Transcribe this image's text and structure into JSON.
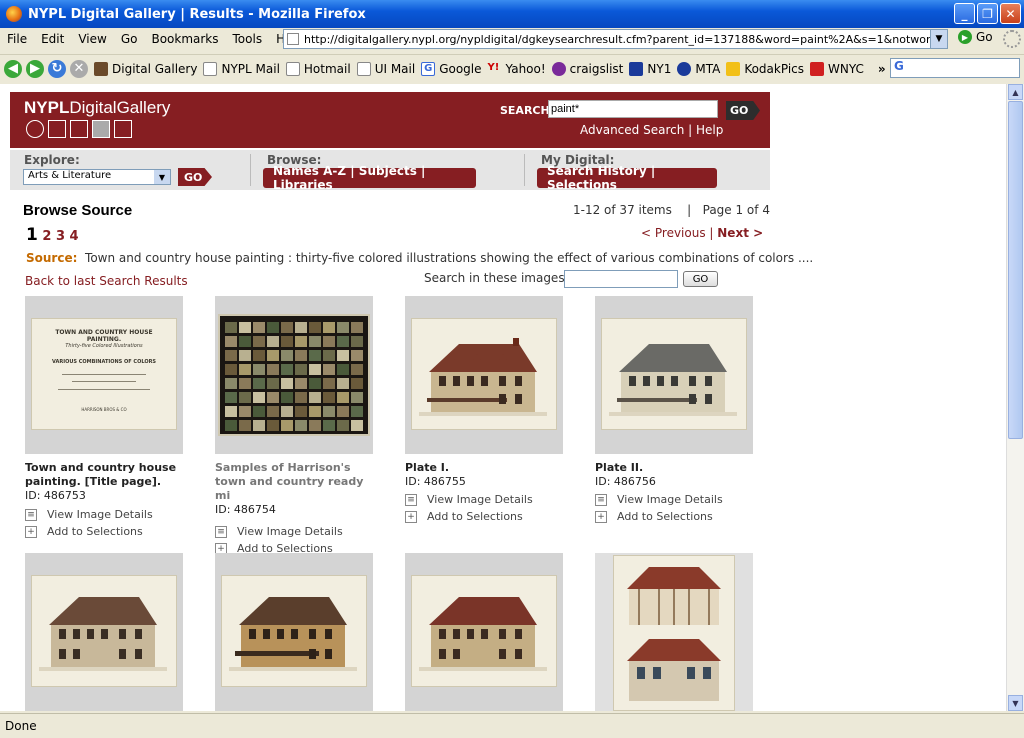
{
  "browser": {
    "window_title": "NYPL Digital Gallery  |  Results - Mozilla Firefox",
    "menu": [
      "File",
      "Edit",
      "View",
      "Go",
      "Bookmarks",
      "Tools",
      "Help"
    ],
    "url": "http://digitalgallery.nypl.org/nypldigital/dgkeysearchresult.cfm?parent_id=137188&word=paint%2A&s=1&notword=&d=bg&c=&",
    "go_label": "Go",
    "bookmarks": [
      "Digital Gallery",
      "NYPL Mail",
      "Hotmail",
      "UI Mail",
      "Google",
      "Yahoo!",
      "craigslist",
      "NY1",
      "MTA",
      "KodakPics",
      "WNYC"
    ],
    "status": "Done"
  },
  "header": {
    "logo_prefix": "NYPL",
    "logo_suffix": "DigitalGallery",
    "search_label": "SEARCH:",
    "search_value": "paint*",
    "go": "GO",
    "advanced": "Advanced Search",
    "sep": " | ",
    "help": "Help"
  },
  "nav": {
    "explore_label": "Explore:",
    "explore_value": "Arts & Literature",
    "explore_go": "GO",
    "browse_label": "Browse:",
    "browse_links": "Names A-Z  |  Subjects  |  Libraries",
    "mydigital_label": "My Digital:",
    "mydigital_links": "Search History  |  Selections"
  },
  "main": {
    "title": "Browse Source",
    "count": "1-12 of 37 items    |   Page 1 of 4",
    "current_page": "1",
    "other_pages": "2 3 4",
    "prev": "< Previous",
    "sep": " | ",
    "next": "Next >",
    "source_label": "Source:",
    "source_text": "Town and country house painting : thirty-five colored illustrations showing the effect of various combinations of colors ....",
    "back_link": "Back to last Search Results",
    "search_images_label": "Search in these images:",
    "search_images_go": "GO",
    "view_details": "View Image Details",
    "add_selections": "Add to Selections"
  },
  "items": [
    {
      "title": "Town and country house painting. [Title page].",
      "id": "ID: 486753"
    },
    {
      "title": "Samples of Harrison's town and country ready mi",
      "id": "ID: 486754"
    },
    {
      "title": "Plate I.",
      "id": "ID: 486755"
    },
    {
      "title": "Plate II.",
      "id": "ID: 486756"
    }
  ],
  "title_page_text": {
    "line1": "TOWN AND COUNTRY HOUSE PAINTING.",
    "line2": "Thirty-five Colored Illustrations",
    "line3": "VARIOUS COMBINATIONS OF COLORS",
    "line4": "HARRISON BROS & CO"
  }
}
